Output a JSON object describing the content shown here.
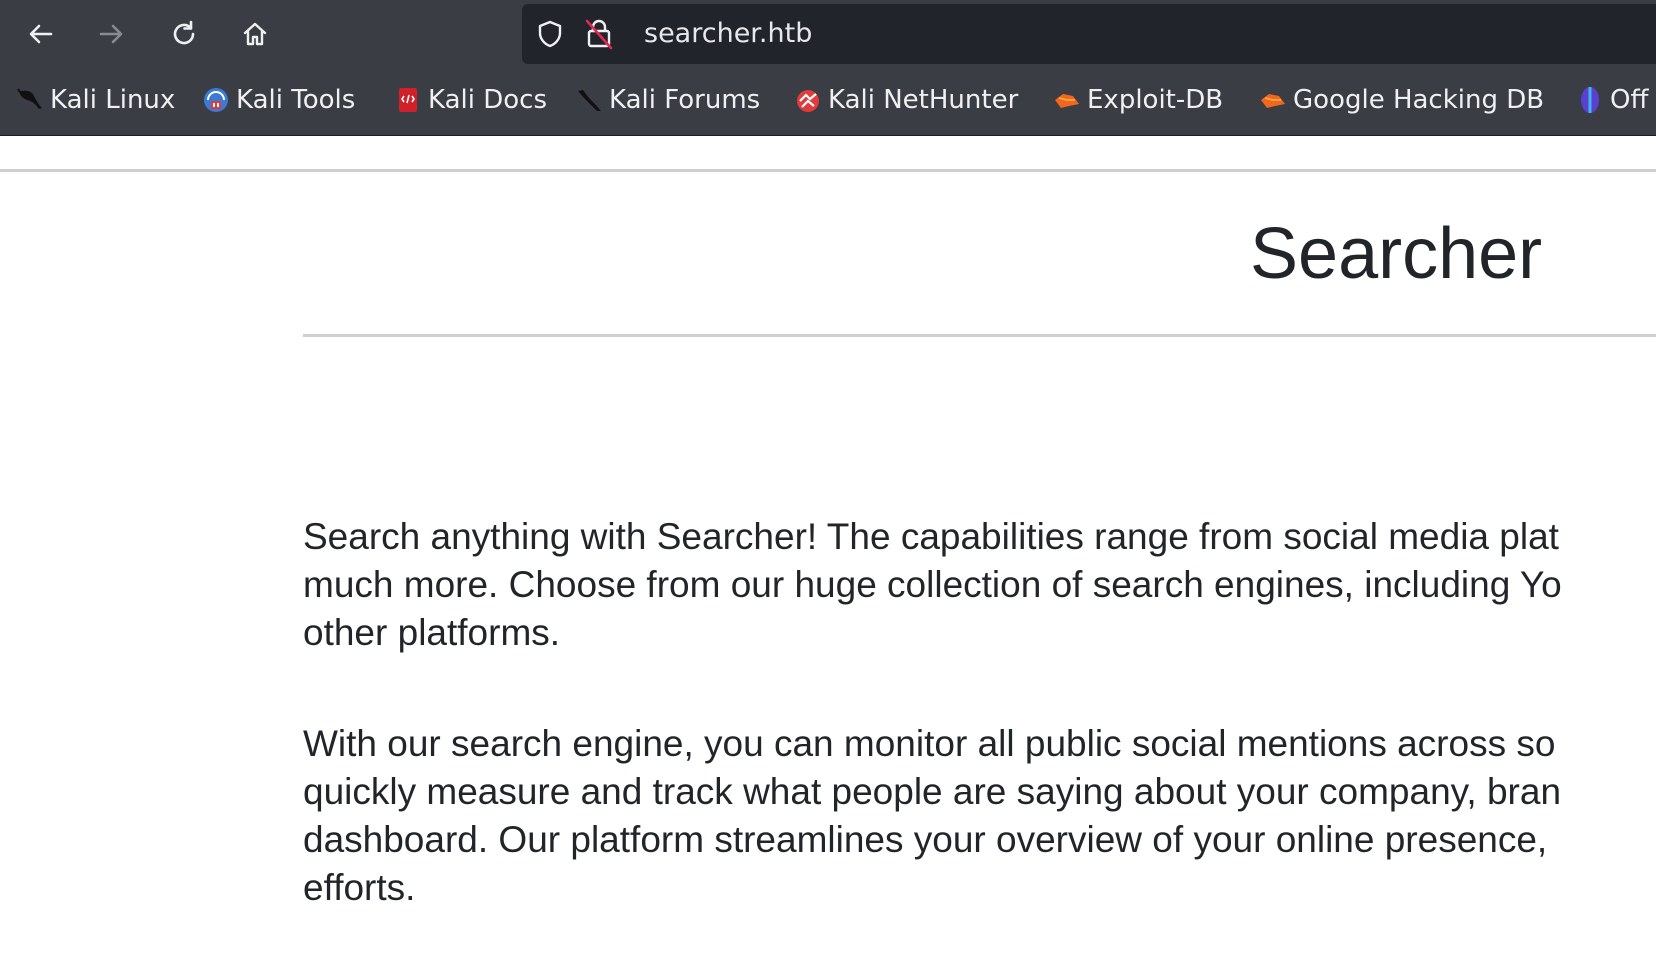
{
  "browser": {
    "url": "searcher.htb",
    "bookmarks": [
      {
        "label": "Kali Linux",
        "icon": "kali-dragon-icon"
      },
      {
        "label": "Kali Tools",
        "icon": "kali-tools-icon"
      },
      {
        "label": "Kali Docs",
        "icon": "kali-docs-icon"
      },
      {
        "label": "Kali Forums",
        "icon": "kali-forums-icon"
      },
      {
        "label": "Kali NetHunter",
        "icon": "kali-nethunter-icon"
      },
      {
        "label": "Exploit-DB",
        "icon": "exploit-db-icon"
      },
      {
        "label": "Google Hacking DB",
        "icon": "google-hacking-db-icon"
      },
      {
        "label": "Off",
        "icon": "offsec-icon"
      }
    ],
    "colors": {
      "toolbar": "#3b3d44",
      "urlbar": "#22242c",
      "text": "#f0f0f2"
    }
  },
  "page": {
    "title": "Searcher",
    "paragraphs": [
      [
        "Search anything with Searcher! The capabilities range from social media plat",
        "much more. Choose from our huge collection of search engines, including Yo",
        "other platforms."
      ],
      [
        "With our search engine, you can monitor all public social mentions across so",
        "quickly measure and track what people are saying about your company, bran",
        "dashboard. Our platform streamlines your overview of your online presence,",
        "efforts."
      ]
    ]
  }
}
